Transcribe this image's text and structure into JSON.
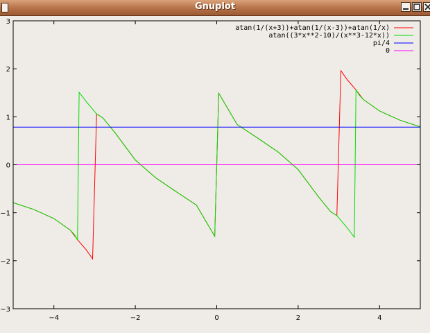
{
  "window": {
    "title": "Gnuplot"
  },
  "chart_data": {
    "type": "line",
    "xlim": [
      -5,
      5
    ],
    "ylim": [
      -3,
      3
    ],
    "xticks": [
      -4,
      -2,
      0,
      2,
      4
    ],
    "yticks": [
      -3,
      -2,
      -1,
      0,
      1,
      2,
      3
    ],
    "grid": false,
    "legend_position": "top-right",
    "legend": [
      "atan(1/(x+3))+atan(1/(x-3))+atan(1/x)",
      "atan((3*x**2-10)/(x**3-12*x))",
      "pi/4",
      "0"
    ],
    "series": [
      {
        "name": "atan(1/(x+3))+atan(1/(x-3))+atan(1/x)",
        "color": "#ff0000",
        "x": [
          -5,
          -4.5,
          -4,
          -3.6,
          -3.4,
          -3.2,
          -3.05,
          -2.95,
          -2.8,
          -2.5,
          -2,
          -1.5,
          -1,
          -0.5,
          -0.05,
          0.05,
          0.5,
          1,
          1.5,
          2,
          2.5,
          2.8,
          2.95,
          3.05,
          3.2,
          3.4,
          3.6,
          4,
          4.5,
          5
        ],
        "y": [
          -0.79,
          -0.93,
          -1.12,
          -1.36,
          -1.58,
          -1.78,
          -1.96,
          1.06,
          0.98,
          0.67,
          0.1,
          -0.27,
          -0.56,
          -0.84,
          -1.49,
          1.49,
          0.84,
          0.56,
          0.27,
          -0.1,
          -0.67,
          -0.98,
          -1.06,
          1.96,
          1.78,
          1.58,
          1.36,
          1.12,
          0.93,
          0.79
        ]
      },
      {
        "name": "atan((3*x**2-10)/(x**3-12*x))",
        "color": "#00dd00",
        "x": [
          -5,
          -4.5,
          -4,
          -3.6,
          -3.5,
          -3.45,
          -3.42,
          -3.38,
          -3.2,
          -3.05,
          -2.95,
          -2.8,
          -2.5,
          -2,
          -1.5,
          -1,
          -0.5,
          -0.05,
          0.05,
          0.5,
          1,
          1.5,
          2,
          2.5,
          2.8,
          2.95,
          3.05,
          3.2,
          3.38,
          3.42,
          3.45,
          3.5,
          3.6,
          4,
          4.5,
          5
        ],
        "y": [
          -0.79,
          -0.93,
          -1.12,
          -1.36,
          -1.45,
          -1.52,
          -1.57,
          1.51,
          1.31,
          1.16,
          1.06,
          0.98,
          0.67,
          0.1,
          -0.27,
          -0.56,
          -0.84,
          -1.49,
          1.49,
          0.84,
          0.56,
          0.27,
          -0.1,
          -0.67,
          -0.98,
          -1.06,
          -1.16,
          -1.31,
          -1.51,
          1.57,
          1.52,
          1.45,
          1.36,
          1.12,
          0.93,
          0.79
        ]
      },
      {
        "name": "pi/4",
        "color": "#0000ff",
        "x": [
          -5,
          5
        ],
        "y": [
          0.785,
          0.785
        ]
      },
      {
        "name": "0",
        "color": "#ff00ff",
        "x": [
          -5,
          5
        ],
        "y": [
          0,
          0
        ]
      }
    ]
  }
}
